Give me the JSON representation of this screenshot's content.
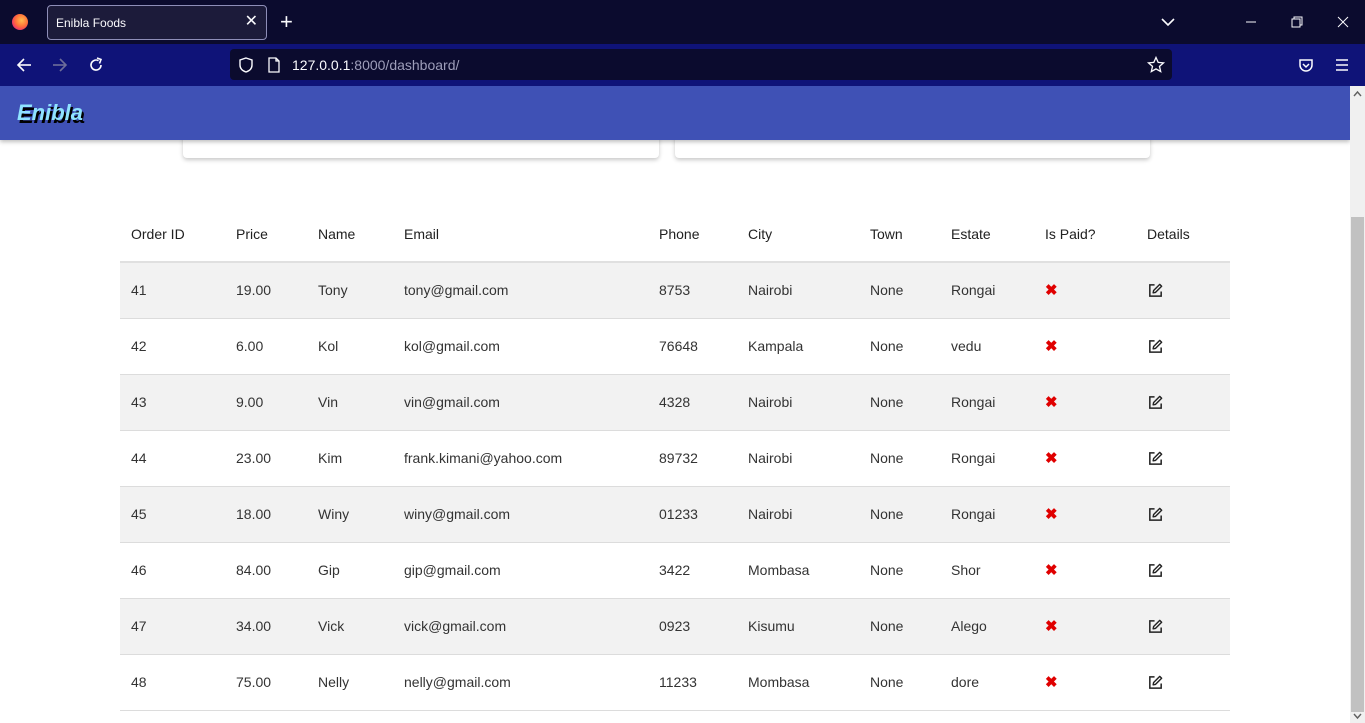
{
  "browser": {
    "tab_title": "Enibla Foods",
    "url_host": "127.0.0.1",
    "url_path": ":8000/dashboard/"
  },
  "app": {
    "brand": "Enibla",
    "colors": {
      "appbar": "#3f51b5",
      "brand_text": "#8fe3ff",
      "unpaid": "#e00000"
    }
  },
  "table": {
    "headers": [
      "Order ID",
      "Price",
      "Name",
      "Email",
      "Phone",
      "City",
      "Town",
      "Estate",
      "Is Paid?",
      "Details"
    ],
    "rows": [
      {
        "id": "41",
        "price": "19.00",
        "name": "Tony",
        "email": "tony@gmail.com",
        "phone": "8753",
        "city": "Nairobi",
        "town": "None",
        "estate": "Rongai",
        "paid": "✖"
      },
      {
        "id": "42",
        "price": "6.00",
        "name": "Kol",
        "email": "kol@gmail.com",
        "phone": "76648",
        "city": "Kampala",
        "town": "None",
        "estate": "vedu",
        "paid": "✖"
      },
      {
        "id": "43",
        "price": "9.00",
        "name": "Vin",
        "email": "vin@gmail.com",
        "phone": "4328",
        "city": "Nairobi",
        "town": "None",
        "estate": "Rongai",
        "paid": "✖"
      },
      {
        "id": "44",
        "price": "23.00",
        "name": "Kim",
        "email": "frank.kimani@yahoo.com",
        "phone": "89732",
        "city": "Nairobi",
        "town": "None",
        "estate": "Rongai",
        "paid": "✖"
      },
      {
        "id": "45",
        "price": "18.00",
        "name": "Winy",
        "email": "winy@gmail.com",
        "phone": "01233",
        "city": "Nairobi",
        "town": "None",
        "estate": "Rongai",
        "paid": "✖"
      },
      {
        "id": "46",
        "price": "84.00",
        "name": "Gip",
        "email": "gip@gmail.com",
        "phone": "3422",
        "city": "Mombasa",
        "town": "None",
        "estate": "Shor",
        "paid": "✖"
      },
      {
        "id": "47",
        "price": "34.00",
        "name": "Vick",
        "email": "vick@gmail.com",
        "phone": "0923",
        "city": "Kisumu",
        "town": "None",
        "estate": "Alego",
        "paid": "✖"
      },
      {
        "id": "48",
        "price": "75.00",
        "name": "Nelly",
        "email": "nelly@gmail.com",
        "phone": "11233",
        "city": "Mombasa",
        "town": "None",
        "estate": "dore",
        "paid": "✖"
      }
    ]
  }
}
